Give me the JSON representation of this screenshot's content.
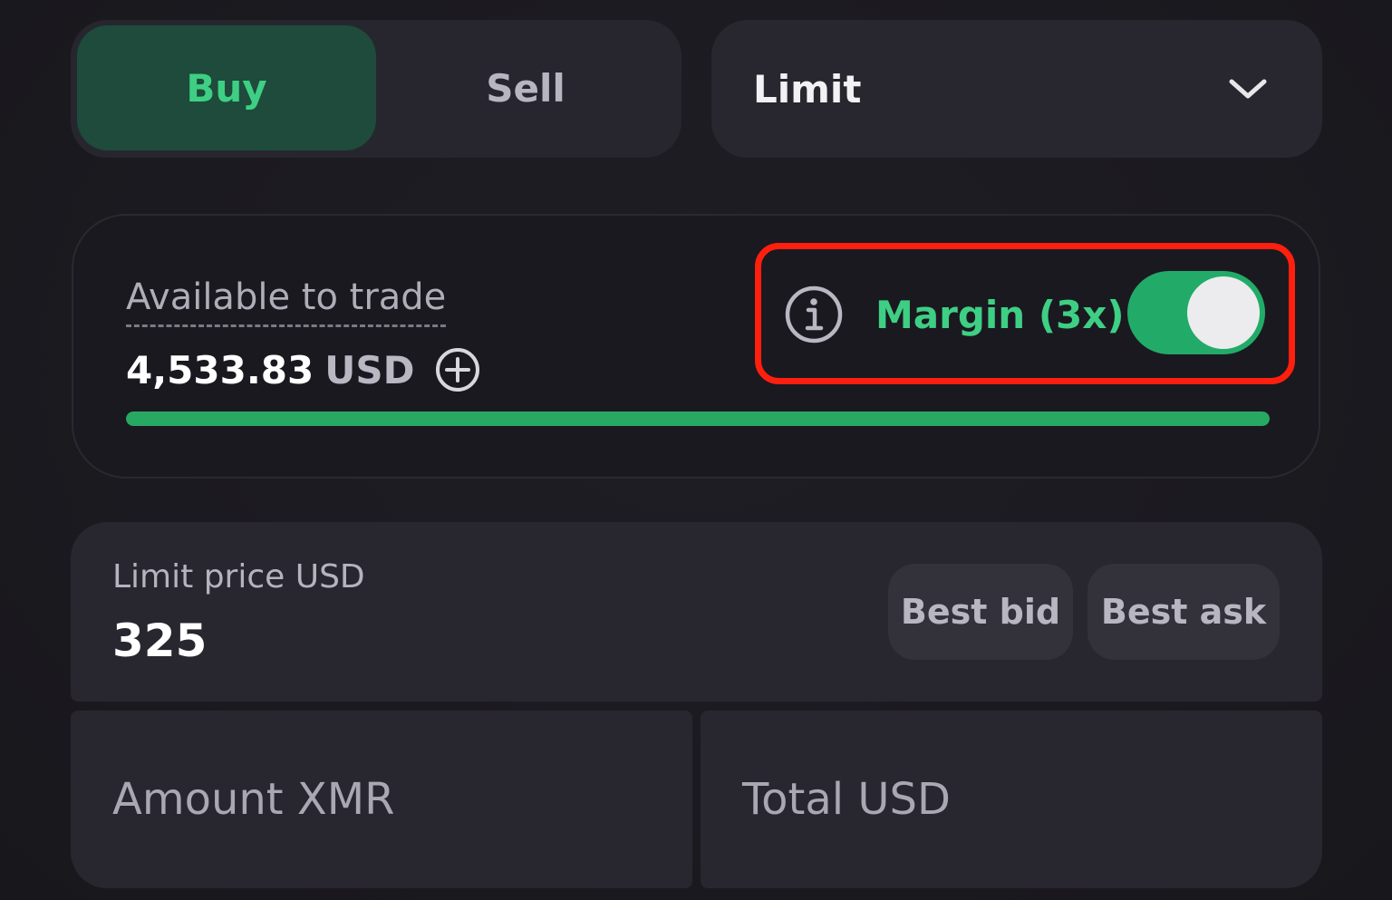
{
  "side_toggle": {
    "buy_label": "Buy",
    "sell_label": "Sell",
    "selected": "Buy"
  },
  "order_type": {
    "selected": "Limit",
    "icon": "chevron-down-icon"
  },
  "available": {
    "label": "Available to trade",
    "amount": "4,533.83",
    "currency": "USD",
    "add_icon": "plus-circle-icon",
    "progress_fraction": 1.0
  },
  "margin": {
    "info_icon": "info-icon",
    "label": "Margin (3x)",
    "enabled": true
  },
  "limit_price": {
    "label": "Limit price USD",
    "value": "325",
    "best_bid_label": "Best bid",
    "best_ask_label": "Best ask"
  },
  "amount_field": {
    "placeholder": "Amount XMR"
  },
  "total_field": {
    "placeholder": "Total USD"
  },
  "colors": {
    "accent_green": "#3ecf84",
    "buy_bg": "#1e4b3b",
    "highlight_red": "#ff1f0f",
    "toggle_on": "#22ab68"
  }
}
